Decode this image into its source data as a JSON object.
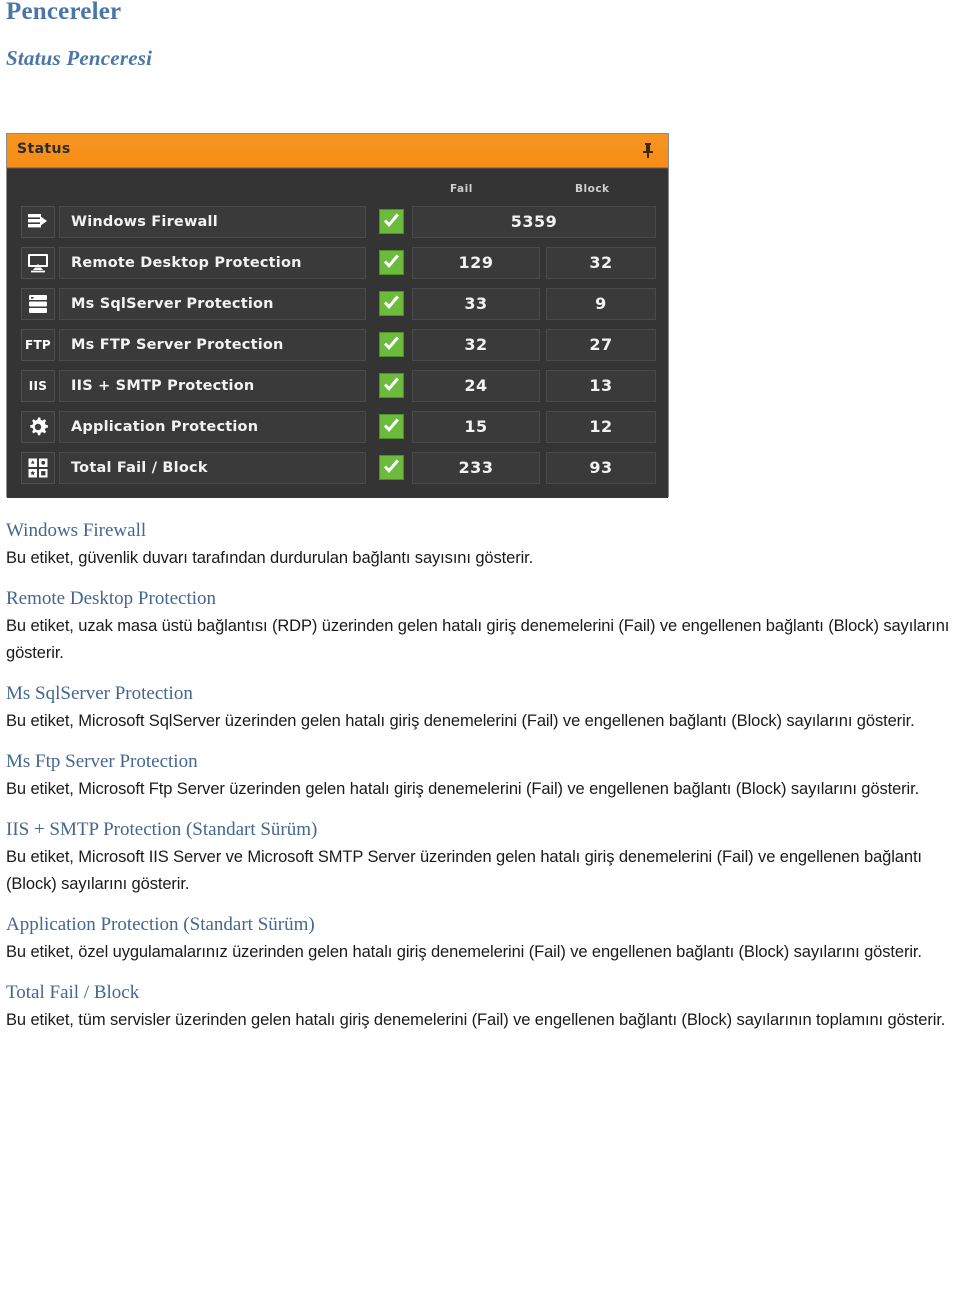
{
  "document": {
    "title": "Pencereler",
    "subtitle": "Status Penceresi"
  },
  "status_window": {
    "titlebar": {
      "title": "Status",
      "pin_icon": "pin-icon"
    },
    "columns": {
      "fail": "Fail",
      "block": "Block"
    },
    "rows": [
      {
        "icon": "firewall-icon",
        "label": "Windows Firewall",
        "checked": true,
        "fail": "5359",
        "block": "",
        "merged": true
      },
      {
        "icon": "monitor-icon",
        "label": "Remote Desktop Protection",
        "checked": true,
        "fail": "129",
        "block": "32",
        "merged": false
      },
      {
        "icon": "database-icon",
        "label": "Ms SqlServer Protection",
        "checked": true,
        "fail": "33",
        "block": "9",
        "merged": false
      },
      {
        "icon": "ftp-icon",
        "label": "Ms FTP Server Protection",
        "checked": true,
        "fail": "32",
        "block": "27",
        "merged": false
      },
      {
        "icon": "iis-icon",
        "label": "IIS + SMTP Protection",
        "checked": true,
        "fail": "24",
        "block": "13",
        "merged": false
      },
      {
        "icon": "gear-icon",
        "label": "Application Protection",
        "checked": true,
        "fail": "15",
        "block": "12",
        "merged": false
      },
      {
        "icon": "grid-icon",
        "label": "Total Fail /  Block",
        "checked": true,
        "fail": "233",
        "block": "93",
        "merged": false
      }
    ],
    "colors": {
      "titlebar": "#f68c14",
      "body": "#343434",
      "check": "#6cbb3c",
      "text": "#f2f2f2"
    }
  },
  "sections": [
    {
      "heading": "Windows Firewall",
      "body": "Bu etiket, güvenlik duvarı tarafından durdurulan bağlantı sayısını gösterir."
    },
    {
      "heading": "Remote Desktop Protection",
      "body": "Bu etiket, uzak masa üstü bağlantısı (RDP) üzerinden gelen hatalı giriş denemelerini (Fail) ve engellenen bağlantı (Block) sayılarını gösterir."
    },
    {
      "heading": "Ms SqlServer Protection",
      "body": "Bu etiket, Microsoft SqlServer  üzerinden gelen hatalı giriş denemelerini (Fail) ve engellenen bağlantı (Block) sayılarını gösterir."
    },
    {
      "heading": "Ms Ftp Server Protection",
      "body": "Bu etiket, Microsoft Ftp Server  üzerinden gelen hatalı giriş denemelerini (Fail) ve engellenen bağlantı (Block) sayılarını gösterir."
    },
    {
      "heading": "IIS + SMTP Protection (Standart Sürüm)",
      "body": "Bu etiket, Microsoft IIS Server ve Microsoft SMTP Server  üzerinden gelen hatalı giriş denemelerini (Fail) ve engellenen bağlantı (Block) sayılarını gösterir."
    },
    {
      "heading": "Application Protection (Standart Sürüm)",
      "body": "Bu etiket, özel uygulamalarınız  üzerinden gelen hatalı giriş denemelerini (Fail) ve engellenen bağlantı (Block) sayılarını gösterir."
    },
    {
      "heading": "Total Fail / Block",
      "body": "Bu etiket, tüm servisler  üzerinden gelen hatalı giriş denemelerini (Fail) ve engellenen bağlantı (Block) sayılarının toplamını gösterir."
    }
  ]
}
